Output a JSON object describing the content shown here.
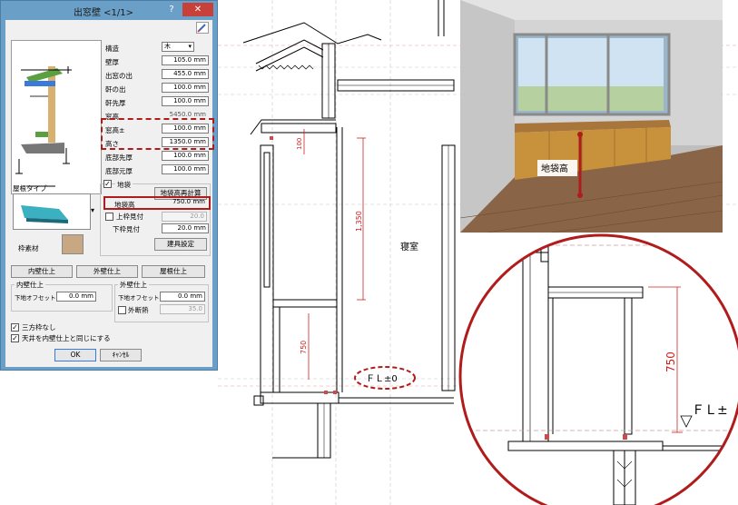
{
  "dialog": {
    "title": "出窓壁 <1/1>",
    "help_label": "?",
    "close_label": "✕",
    "fields": {
      "kozo_label": "構造",
      "kozo_value": "木",
      "hekiatsu_label": "壁厚",
      "hekiatsu_value": "105.0 mm",
      "demado_label": "出窓の出",
      "demado_value": "455.0 mm",
      "nokide_label": "軒の出",
      "nokide_value": "100.0 mm",
      "nokisaki_label": "軒先厚",
      "nokisaki_value": "100.0 mm",
      "madotaka_label": "窓高",
      "madotaka_value": "5450.0 mm",
      "madotaka2_label": "窓高±",
      "madotaka2_value": "100.0 mm",
      "takasa_label": "高さ",
      "takasa_value": "1350.0 mm",
      "teibusaki_label": "底部先厚",
      "teibusaki_value": "100.0 mm",
      "teibumoto_label": "底部元厚",
      "teibumoto_value": "100.0 mm"
    },
    "yane_type_label": "屋根タイプ",
    "jibukuro_label": "地袋",
    "jibukuro_calc_button": "地袋高再計算",
    "jibukuro_height_label": "地袋高",
    "jibukuro_height_value": "750.0 mm",
    "uwawaku_label": "上枠見付",
    "uwawaku_value": "20.0",
    "shitawaku_label": "下枠見付",
    "shitawaku_value": "20.0 mm",
    "waku_sozai_label": "枠素材",
    "tategu_button": "建具設定",
    "naiheki_button": "内壁仕上",
    "gaiheki_button": "外壁仕上",
    "yane_button": "屋根仕上",
    "naiheki_group": "内壁仕上",
    "gaiheki_group": "外壁仕上",
    "shitaji_label_1": "下地オフセット",
    "shitaji_value_1": "0.0 mm",
    "shitaji_label_2": "下地オフセット",
    "shitaji_value_2": "0.0 mm",
    "gaidannetsu_label": "外断熱",
    "gaidannetsu_value": "35.0",
    "sanpo_label": "三方枠なし",
    "tenjo_label": "天井を内壁仕上と同じにする",
    "ok_button": "OK",
    "cancel_button": "ｷｬﾝｾﾙ"
  },
  "drawing": {
    "dim_100": "100",
    "dim_1350": "1,350",
    "dim_750": "750",
    "room_label": "寝室",
    "fl_label": "ＦＬ±0",
    "zoom_dim_750": "750",
    "zoom_fl_label": "ＦＬ±"
  },
  "render3d": {
    "jibukuro_label": "地袋高"
  },
  "colors": {
    "accent_red": "#b01c1c",
    "titlebar_blue": "#6aa0c8",
    "wood": "#c8923c",
    "floor": "#8a6446"
  }
}
